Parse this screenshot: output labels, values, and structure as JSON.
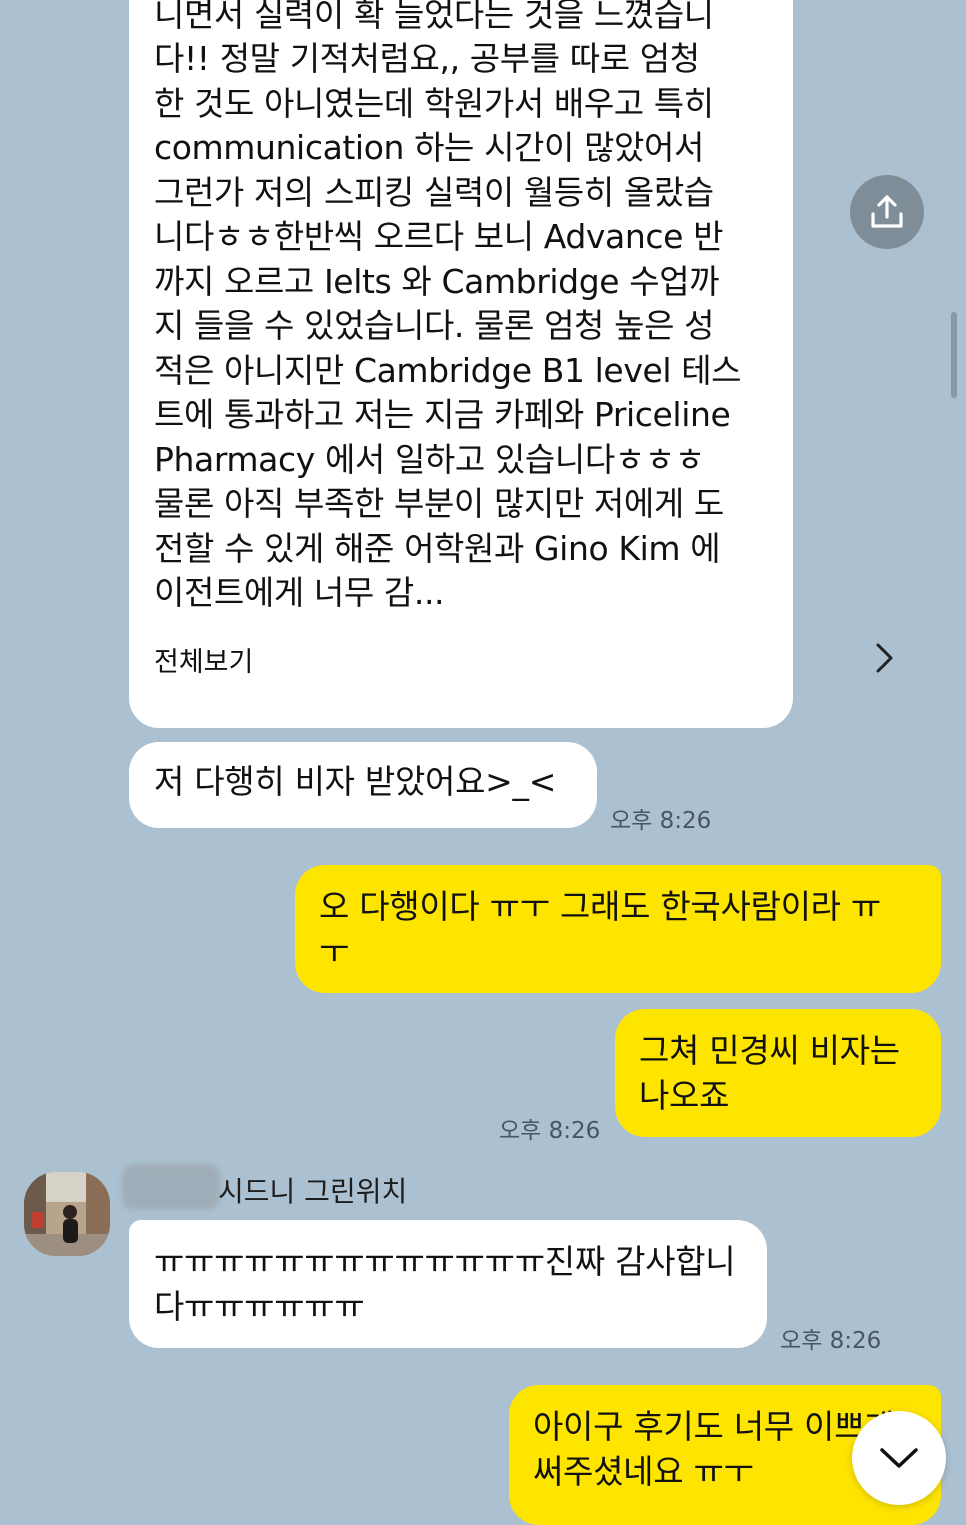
{
  "messages": {
    "long_text": "습니다. 그런데 Greenwich 어학원을 다\n니면서 실력이 확 늘었다는 것을 느꼈습니\n다!! 정말 기적처럼요,, 공부를 따로 엄청\n한 것도 아니였는데 학원가서 배우고 특히\ncommunication 하는 시간이 많았어서\n그런가 저의 스피킹 실력이 월등히 올랐습\n니다ㅎㅎ한반씩 오르다 보니 Advance 반\n까지 오르고 Ielts 와 Cambridge 수업까\n지 들을 수 있었습니다. 물론 엄청 높은 성\n적은 아니지만 Cambridge B1 level 테스\n트에 통과하고 저는 지금 카페와 Priceline\nPharmacy 에서 일하고 있습니다ㅎㅎㅎ\n물론 아직 부족한 부분이 많지만 저에게 도\n전할 수 있게 해준 어학원과 Gino Kim 에\n이전트에게 너무 감...",
    "view_all_label": "전체보기",
    "msg_visa": "저 다행히 비자 받았어요>_<",
    "time_1": "오후 8:26",
    "msg_relief": "오 다행이다 ㅠㅜ 그래도 한국사람이라 ㅠ\nㅜ",
    "msg_minkyung": "그쳐 민경씨 비자는\n나오죠",
    "time_2": "오후 8:26",
    "sender_name": "시드니 그린위치",
    "msg_thanks": "ㅠㅠㅠㅠㅠㅠㅠㅠㅠㅠㅠㅠㅠ진짜 감사합니\n다ㅠㅠㅠㅠㅠㅠ",
    "time_3": "오후 8:26",
    "msg_review": "아이구 후기도 너무 이쁘게\n써주셨네요 ㅠㅜ"
  },
  "colors": {
    "background": "#abc1d1",
    "incoming_bubble": "#ffffff",
    "outgoing_bubble": "#fee500"
  },
  "icons": {
    "share": "share-upload-icon",
    "view_all": "chevron-right-icon",
    "scroll_down": "chevron-down-icon"
  }
}
